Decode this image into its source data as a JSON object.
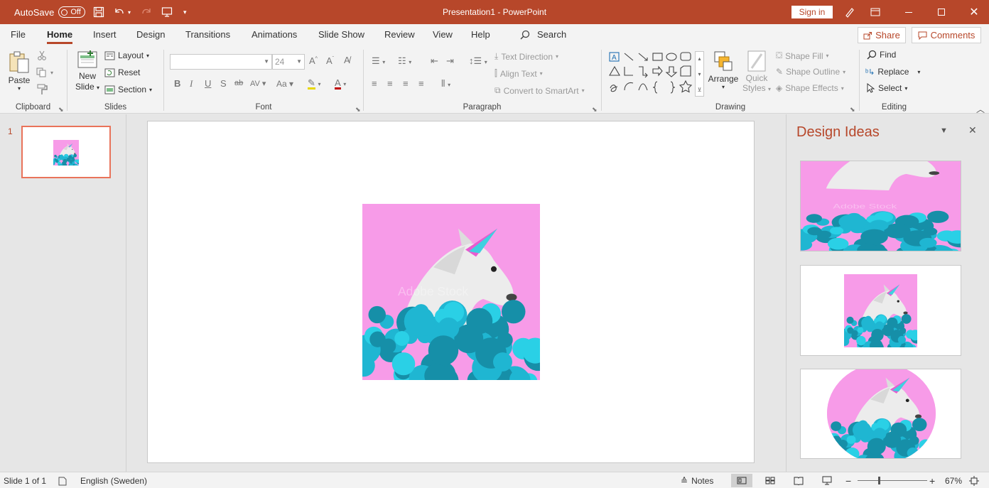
{
  "titlebar": {
    "autosave_label": "AutoSave",
    "autosave_state": "Off",
    "document_title": "Presentation1  -  PowerPoint",
    "sign_in": "Sign in",
    "qat_icons": [
      "save-icon",
      "undo-icon",
      "redo-icon",
      "present-icon",
      "customize-icon"
    ],
    "window_icons": [
      "pen-icon",
      "ribbon-display-icon",
      "minimize-icon",
      "maximize-icon",
      "close-icon"
    ]
  },
  "tabs": [
    "File",
    "Home",
    "Insert",
    "Design",
    "Transitions",
    "Animations",
    "Slide Show",
    "Review",
    "View",
    "Help"
  ],
  "active_tab": "Home",
  "search_label": "Search",
  "share_label": "Share",
  "comments_label": "Comments",
  "ribbon": {
    "clipboard": {
      "label": "Clipboard",
      "paste": "Paste"
    },
    "slides": {
      "label": "Slides",
      "new_slide_1": "New",
      "new_slide_2": "Slide",
      "layout": "Layout",
      "reset": "Reset",
      "section": "Section"
    },
    "font": {
      "label": "Font",
      "font_name": "",
      "font_size": "24"
    },
    "paragraph": {
      "label": "Paragraph",
      "text_direction": "Text Direction",
      "align_text": "Align Text",
      "convert_smartart": "Convert to SmartArt"
    },
    "drawing": {
      "label": "Drawing",
      "arrange": "Arrange",
      "quick_styles_1": "Quick",
      "quick_styles_2": "Styles",
      "shape_fill": "Shape Fill",
      "shape_outline": "Shape Outline",
      "shape_effects": "Shape Effects"
    },
    "editing": {
      "label": "Editing",
      "find": "Find",
      "replace": "Replace",
      "select": "Select"
    }
  },
  "thumbnails": {
    "slide_number": "1"
  },
  "slide": {
    "watermark": "Adobe Stock"
  },
  "design_pane": {
    "title": "Design Ideas"
  },
  "statusbar": {
    "slide_info": "Slide 1 of 1",
    "language": "English (Sweden)",
    "notes": "Notes",
    "zoom": "67%"
  },
  "colors": {
    "accent": "#b7472a",
    "pink": "#f79be8",
    "cyan": "#29c4dc"
  }
}
